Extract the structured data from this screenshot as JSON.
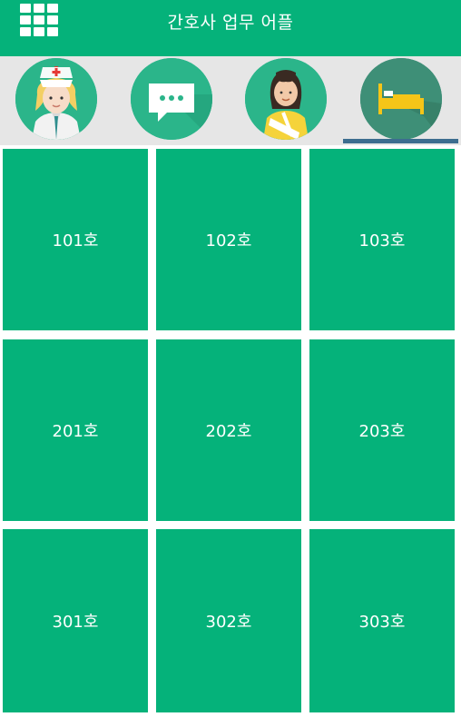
{
  "app": {
    "title": "간호사 업무 어플"
  },
  "tabs": [
    {
      "icon": "nurse-icon"
    },
    {
      "icon": "chat-bubble-icon"
    },
    {
      "icon": "patient-icon"
    },
    {
      "icon": "bed-icon",
      "selected": true
    }
  ],
  "rooms": [
    {
      "label": "101호"
    },
    {
      "label": "102호"
    },
    {
      "label": "103호"
    },
    {
      "label": "201호"
    },
    {
      "label": "202호"
    },
    {
      "label": "203호"
    },
    {
      "label": "301호"
    },
    {
      "label": "302호"
    },
    {
      "label": "303호"
    }
  ],
  "colors": {
    "primary": "#05b27a",
    "tab_circle": "#2bb58a",
    "selected_circle": "#3e8f77",
    "indicator": "#3c6d8f",
    "background": "#e6e6e6"
  }
}
